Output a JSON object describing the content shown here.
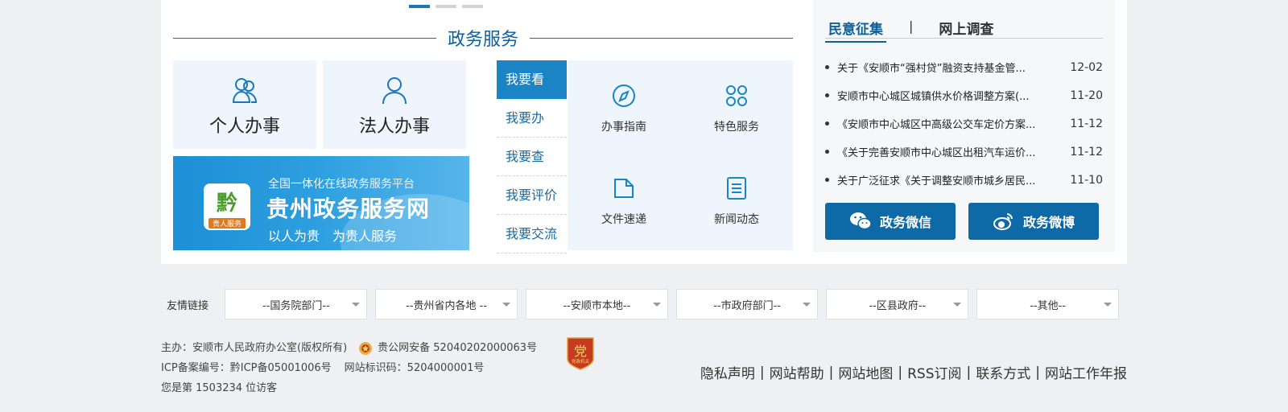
{
  "carousel": {
    "active_index": 0,
    "count": 3
  },
  "gov_services": {
    "title": "政务服务",
    "tiles": [
      {
        "label": "个人办事",
        "icon": "people-icon"
      },
      {
        "label": "法人办事",
        "icon": "person-icon"
      }
    ],
    "banner": {
      "subtitle": "全国一体化在线政务服务平台",
      "title": "贵州政务服务网",
      "slogan": "以人为贵　为贵人服务",
      "logo_mark": "黔",
      "logo_sub": "贵人服务"
    },
    "tabs": [
      "我要看",
      "我要办",
      "我要查",
      "我要评价",
      "我要交流"
    ],
    "active_tab": 0,
    "services": [
      {
        "label": "办事指南",
        "icon": "compass-icon"
      },
      {
        "label": "特色服务",
        "icon": "clover-icon"
      },
      {
        "label": "文件速递",
        "icon": "folder-icon"
      },
      {
        "label": "新闻动态",
        "icon": "document-icon"
      }
    ]
  },
  "opinion": {
    "tabs": [
      "民意征集",
      "网上调查"
    ],
    "separator": "|",
    "active_tab": 0,
    "items": [
      {
        "title": "关于《安顺市“强村贷”融资支持基金管...",
        "date": "12-02"
      },
      {
        "title": "安顺市中心城区城镇供水价格调整方案(...",
        "date": "11-20"
      },
      {
        "title": "《安顺市中心城区中高级公交车定价方案...",
        "date": "11-12"
      },
      {
        "title": "《关于完善安顺市中心城区出租汽车运价...",
        "date": "11-12"
      },
      {
        "title": "关于广泛征求《关于调整安顺市城乡居民...",
        "date": "11-10"
      }
    ],
    "wechat_label": "政务微信",
    "weibo_label": "政务微博"
  },
  "friend_links": {
    "label": "友情链接",
    "selects": [
      "--国务院部门--",
      "--贵州省内各地 --",
      "--安顺市本地--",
      "--市政府部门--",
      "--区县政府--",
      "--其他--"
    ]
  },
  "footer": {
    "host": "主办：安顺市人民政府办公室(版权所有)",
    "police_record": "贵公网安备 52040202000063号",
    "icp": "ICP备案编号：黔ICP备05001006号",
    "site_id": "网站标识码：5204000001号",
    "visitors": "您是第 1503234 位访客",
    "links": [
      "隐私声明",
      "网站帮助",
      "网站地图",
      "RSS订阅",
      "联系方式",
      "网站工作年报"
    ],
    "separator": "|",
    "badge_top": "党",
    "badge_bottom": "党政机关"
  }
}
